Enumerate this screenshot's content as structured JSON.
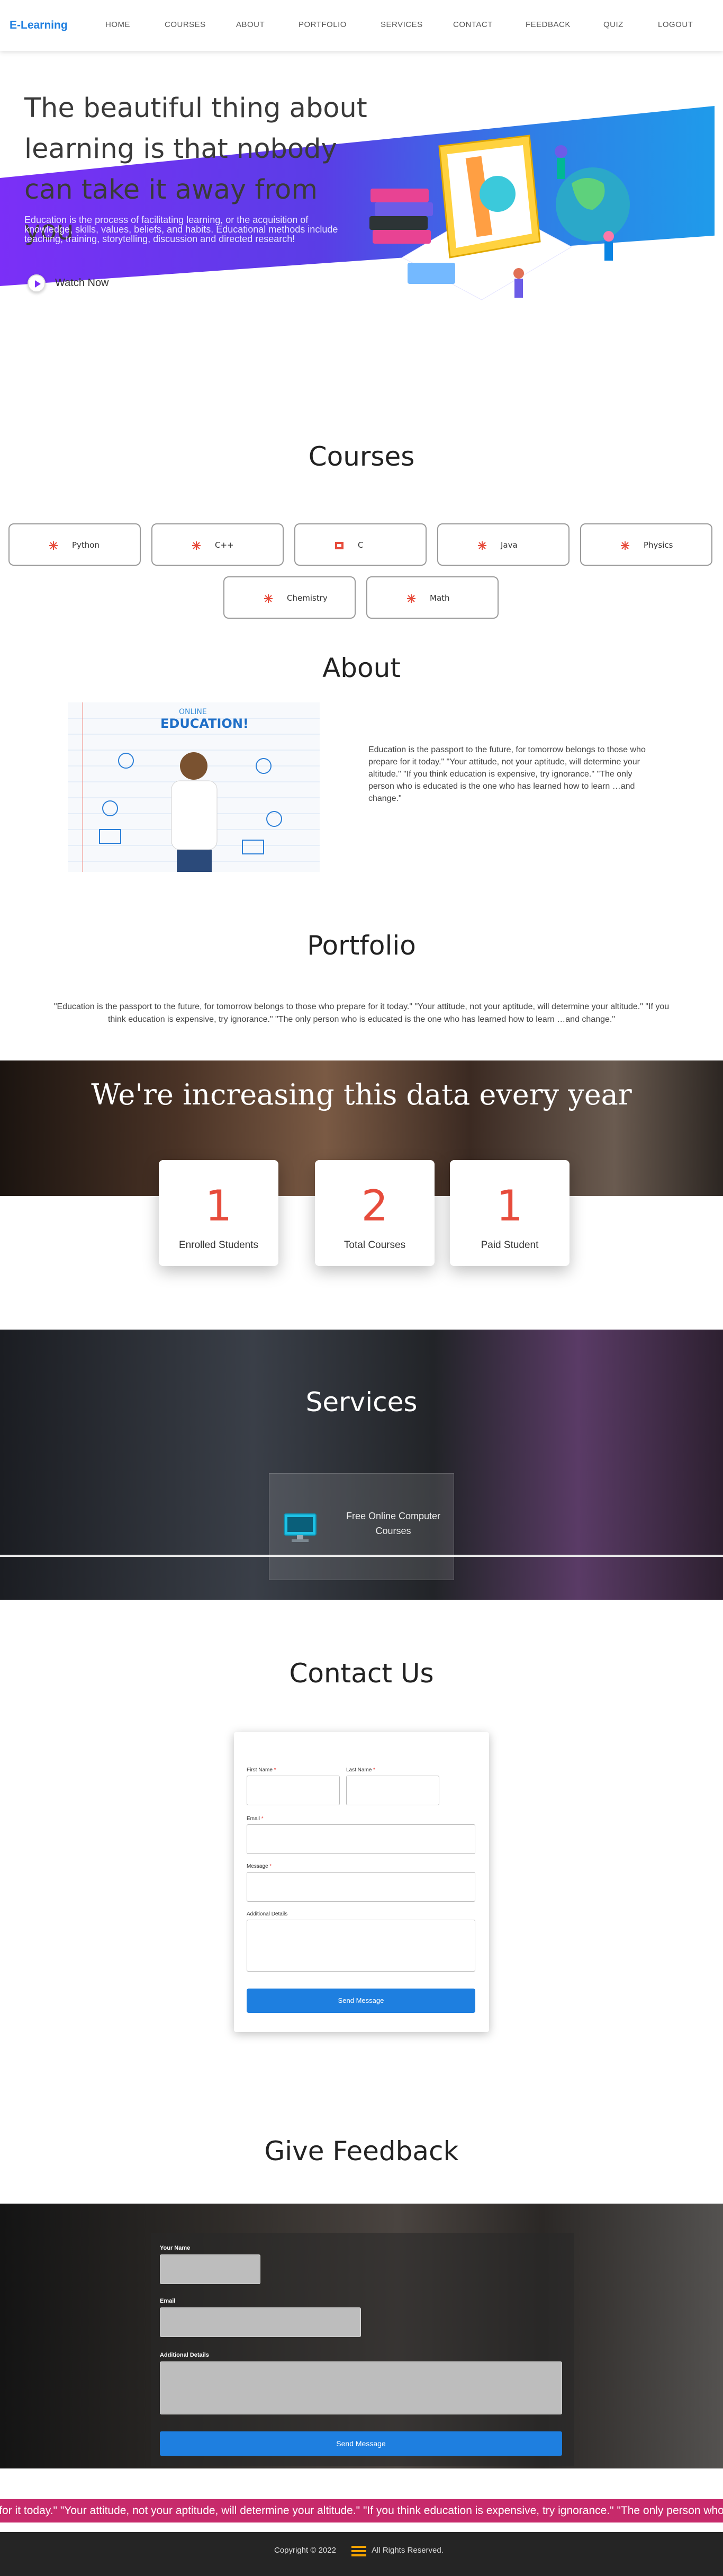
{
  "nav": {
    "brand": "E-Learning",
    "items": [
      "HOME",
      "COURSES",
      "ABOUT",
      "PORTFOLIO",
      "SERVICES",
      "CONTACT",
      "FEEDBACK",
      "QUIZ",
      "LOGOUT"
    ]
  },
  "hero": {
    "title": "The beautiful thing about learning is that nobody can take it away from you",
    "text": "Education is the process of facilitating learning, or the acquisition of knowledge, skills, values, beliefs, and habits. Educational methods include teaching, training, storytelling, discussion and directed research!",
    "watch_label": "Watch Now"
  },
  "courses": {
    "title": "Courses",
    "items": [
      "Python",
      "C++",
      "C",
      "Java",
      "Physics",
      "Chemistry",
      "Math"
    ]
  },
  "about": {
    "title": "About",
    "image_text": {
      "l1": "ONLINE",
      "l2": "EDUCATION!"
    },
    "text": "Education is the passport to the future, for tomorrow belongs to those who prepare for it today.\" \"Your attitude, not your aptitude, will determine your altitude.\" \"If you think education is expensive, try ignorance.\" \"The only person who is educated is the one who has learned how to learn …and change.\""
  },
  "portfolio": {
    "title": "Portfolio",
    "quote": "\"Education is the passport to the future, for tomorrow belongs to those who prepare for it today.\" \"Your attitude, not your aptitude, will determine your altitude.\" \"If you think education is expensive, try ignorance.\" \"The only person who is educated is the one who has learned how to learn …and change.\""
  },
  "stats": {
    "title": "We're increasing this data every year",
    "items": [
      {
        "value": "1",
        "label": "Enrolled Students"
      },
      {
        "value": "2",
        "label": "Total Courses"
      },
      {
        "value": "1",
        "label": "Paid Student"
      }
    ]
  },
  "services": {
    "title": "Services",
    "card_label": "Free Online Computer Courses"
  },
  "contact": {
    "title": "Contact Us",
    "first_name": "First Name",
    "last_name": "Last Name",
    "email": "Email",
    "message": "Message",
    "additional": "Additional Details",
    "required_mark": "*",
    "send": "Send Message"
  },
  "feedback": {
    "title": "Give Feedback",
    "name": "Your Name",
    "email": "Email",
    "details": "Additional Details",
    "send": "Send Message"
  },
  "marquee": "prepare for it today.\" \"Your attitude, not your aptitude, will determine your altitude.\" \"If you think education is expensive, try ignorance.\" \"The only person who is educated is the one who has learned how to learn …and change.\" \"Education is the passport to the future, for tomorrow belongs to those who",
  "footer": {
    "copyright": "Copyright © 2022",
    "rights": "All Rights Reserved."
  },
  "colors": {
    "accent": "#1e7fe0",
    "hero_purple": "#7b2ff7",
    "stat_red": "#e74c3c",
    "marquee": "#c72a6b"
  }
}
